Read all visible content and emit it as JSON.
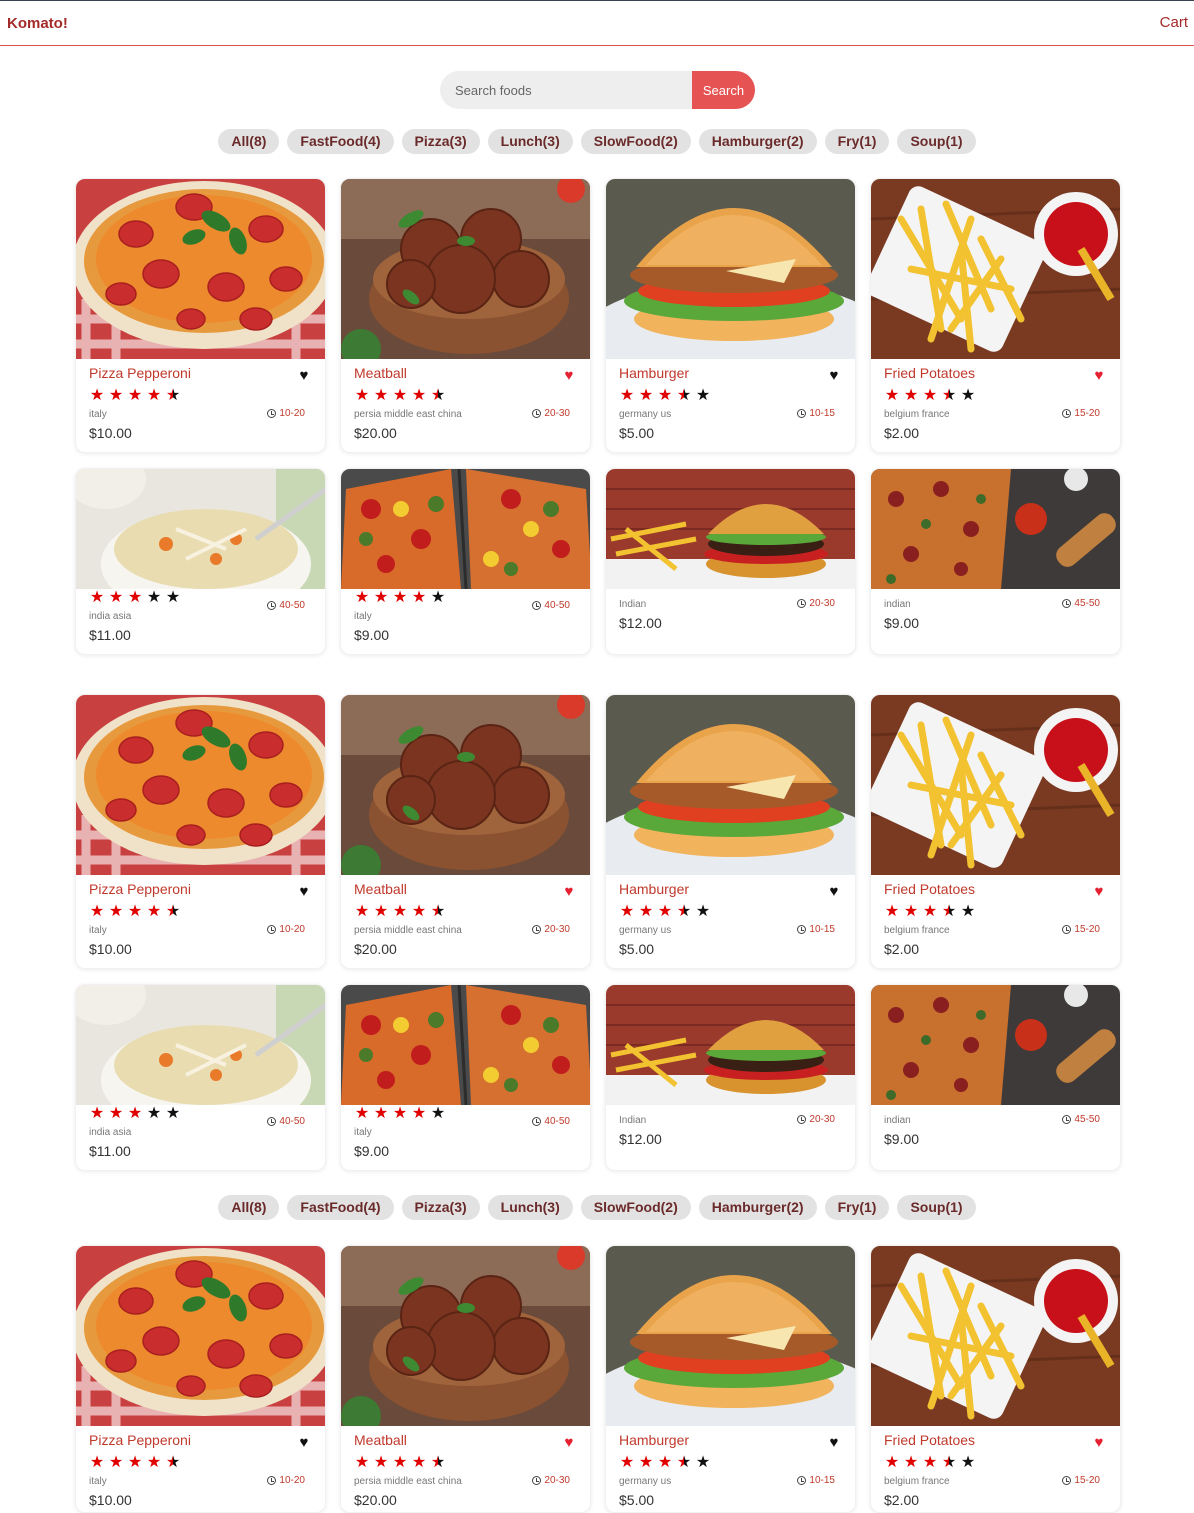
{
  "header": {
    "logo": "Komato!",
    "cart_label": "Cart"
  },
  "search": {
    "placeholder": "Search foods",
    "value": "",
    "button_label": "Search"
  },
  "tags": [
    "All(8)",
    "FastFood(4)",
    "Pizza(3)",
    "Lunch(3)",
    "SlowFood(2)",
    "Hamburger(2)",
    "Fry(1)",
    "Soup(1)"
  ],
  "colors": {
    "brand": "#a52a2a",
    "accent": "#e55353",
    "star": "#e00000",
    "favorite_on": "#e52030"
  },
  "foods": [
    {
      "name": "Pizza Pepperoni",
      "stars": 4.5,
      "origin": "italy",
      "cook_time": "10-20",
      "price": "$10.00",
      "favorite": false,
      "image": "pizza-pepperoni"
    },
    {
      "name": "Meatball",
      "stars": 4.5,
      "origin": "persia middle east china",
      "cook_time": "20-30",
      "price": "$20.00",
      "favorite": true,
      "image": "meatball"
    },
    {
      "name": "Hamburger",
      "stars": 3.5,
      "origin": "germany us",
      "cook_time": "10-15",
      "price": "$5.00",
      "favorite": false,
      "image": "hamburger"
    },
    {
      "name": "Fried Potatoes",
      "stars": 3.5,
      "origin": "belgium france",
      "cook_time": "15-20",
      "price": "$2.00",
      "favorite": true,
      "image": "fried-potatoes"
    },
    {
      "name": "",
      "stars": 3,
      "origin": "india asia",
      "cook_time": "40-50",
      "price": "$11.00",
      "favorite": null,
      "image": "chicken-soup"
    },
    {
      "name": "",
      "stars": 4,
      "origin": "italy",
      "cook_time": "40-50",
      "price": "$9.00",
      "favorite": null,
      "image": "vegetable-pizza"
    },
    {
      "name": "",
      "stars": null,
      "origin": "Indian",
      "cook_time": "20-30",
      "price": "$12.00",
      "favorite": null,
      "image": "burger-fries"
    },
    {
      "name": "",
      "stars": null,
      "origin": "indian",
      "cook_time": "45-50",
      "price": "$9.00",
      "favorite": null,
      "image": "pizza-board"
    }
  ]
}
